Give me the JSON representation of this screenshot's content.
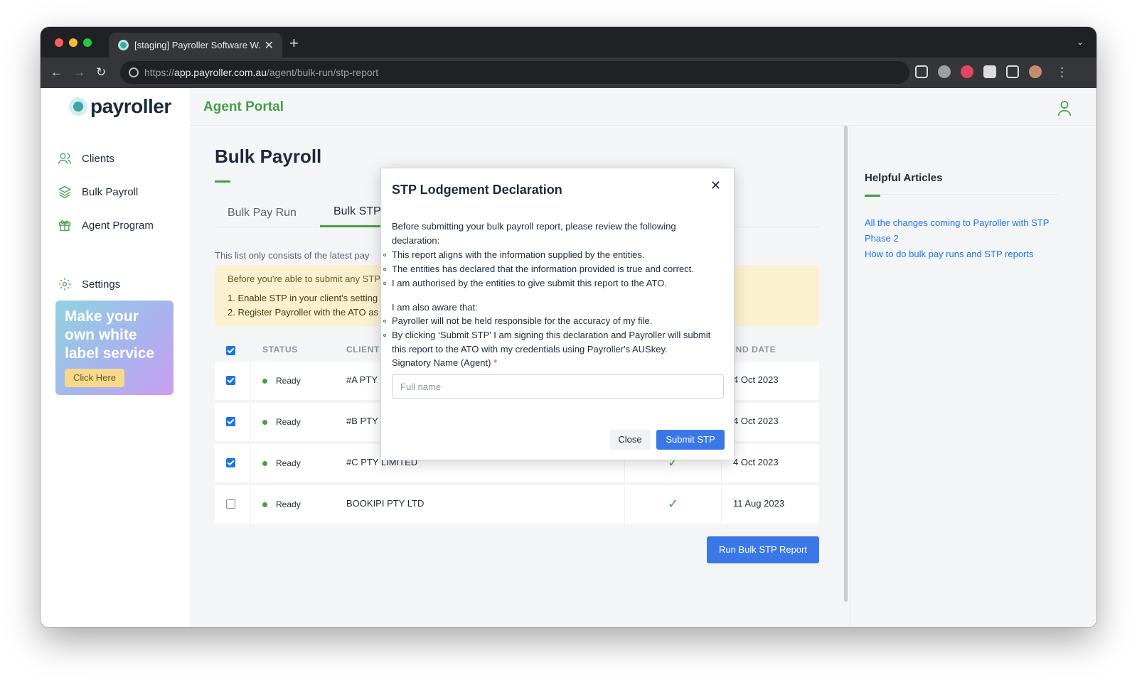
{
  "browser": {
    "tab_title": "[staging] Payroller Software W...",
    "url_prefix": "https://",
    "url_host": "app.payroller.com.au",
    "url_path": "/agent/bulk-run/stp-report"
  },
  "sidebar": {
    "logo": "payroller",
    "items": [
      {
        "label": "Clients",
        "icon": "users-icon"
      },
      {
        "label": "Bulk Payroll",
        "icon": "layers-icon"
      },
      {
        "label": "Agent Program",
        "icon": "gift-icon"
      },
      {
        "label": "Settings",
        "icon": "gear-icon"
      }
    ],
    "promo": {
      "text": "Make your own white label service",
      "button": "Click Here"
    }
  },
  "header": {
    "portal": "Agent Portal"
  },
  "main": {
    "title": "Bulk Payroll",
    "tabs": [
      "Bulk Pay Run",
      "Bulk STP"
    ],
    "list_note": "This list only consists of the latest pay",
    "warning": {
      "line1": "Before you're able to submit any STP",
      "item1": "1. Enable STP in your client's setting",
      "item2": "2. Register Payroller with the ATO as"
    },
    "table": {
      "headers": [
        "STATUS",
        "CLIENT",
        "END DATE"
      ],
      "rows": [
        {
          "checked": true,
          "status": "Ready",
          "client": "#A PTY",
          "date": "4 Oct 2023"
        },
        {
          "checked": true,
          "status": "Ready",
          "client": "#B PTY LIMITED",
          "date": "4 Oct 2023"
        },
        {
          "checked": true,
          "status": "Ready",
          "client": "#C PTY LIMITED",
          "date": "4 Oct 2023"
        },
        {
          "checked": false,
          "status": "Ready",
          "client": "BOOKIPI PTY LTD",
          "date": "11 Aug 2023"
        }
      ]
    },
    "run_button": "Run Bulk STP Report"
  },
  "right": {
    "title": "Helpful Articles",
    "links": [
      "All the changes coming to Payroller with STP Phase 2",
      "How to do bulk pay runs and STP reports"
    ]
  },
  "modal": {
    "title": "STP Lodgement Declaration",
    "intro": "Before submitting your bulk payroll report, please review the following declaration:",
    "points": [
      "This report aligns with the information supplied by the entities.",
      "The entities has declared that the information provided is true and correct.",
      "I am authorised by the entities to give submit this report to the ATO."
    ],
    "aware": "I am also aware that:",
    "aware_points": [
      "Payroller will not be held responsible for the accuracy of my file.",
      "By clicking ‘Submit STP’ I am signing this declaration and Payroller will submit this report to the ATO with my credentials using Payroller's AUSkey."
    ],
    "signatory_label": "Signatory Name (Agent)",
    "required_mark": "*",
    "input_placeholder": "Full name",
    "close_label": "Close",
    "submit_label": "Submit STP"
  },
  "colors": {
    "brand_green": "#43a047",
    "primary_blue": "#3b78e7",
    "teal": "#3ca6a6"
  }
}
